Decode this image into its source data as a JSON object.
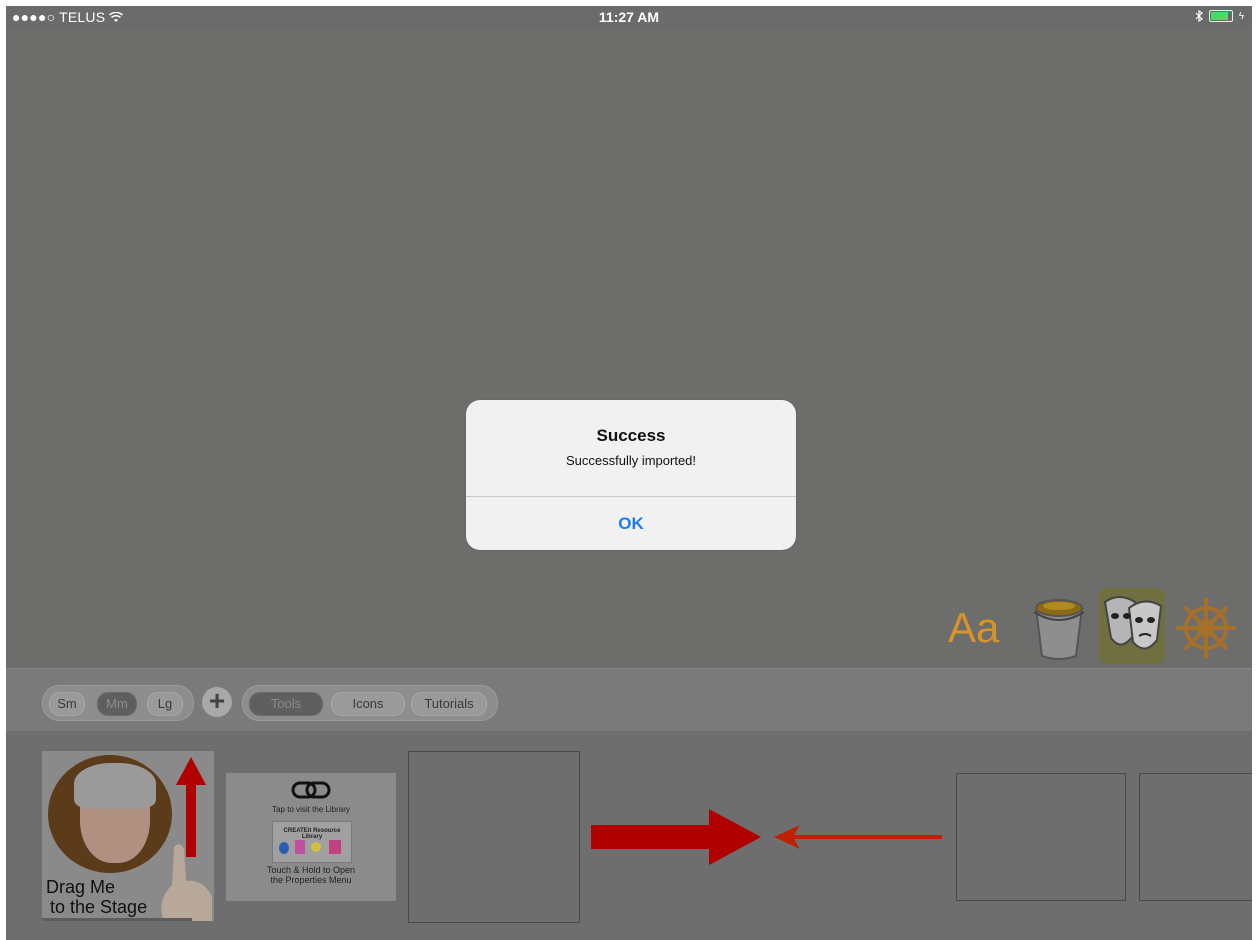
{
  "status_bar": {
    "carrier": "●●●●○ TELUS",
    "wifi_icon": "wifi-icon",
    "time": "11:27 AM",
    "bluetooth_icon": "bluetooth-icon",
    "battery_icon": "battery-icon"
  },
  "tools": {
    "text_tool_label": "Aa",
    "paint_bucket_icon": "paint-bucket-icon",
    "theater_mask_icon": "theater-mask-icon",
    "ship_wheel_icon": "ship-wheel-icon"
  },
  "toolbar": {
    "sizes": [
      "Sm",
      "Mm",
      "Lg"
    ],
    "active_size": "Mm",
    "add_label": "+",
    "tabs": [
      "Tools",
      "Icons",
      "Tutorials"
    ],
    "active_tab": "Tools"
  },
  "tray": {
    "card1_label_line1": "Drag Me",
    "card1_label_line2": "to the Stage",
    "card2_link_icon": "link-icon",
    "card2_top_text": "Tap to visit the Library",
    "card2_mini_text": "CREATEit Resource Library",
    "card2_bottom_line1": "Touch & Hold to Open",
    "card2_bottom_line2": "the Properties Menu"
  },
  "dialog": {
    "title": "Success",
    "message": "Successfully imported!",
    "ok_label": "OK"
  },
  "colors": {
    "accent_blue": "#1a7cf5",
    "arrow_red": "#c00000",
    "text_tool_orange": "#d8932a"
  }
}
